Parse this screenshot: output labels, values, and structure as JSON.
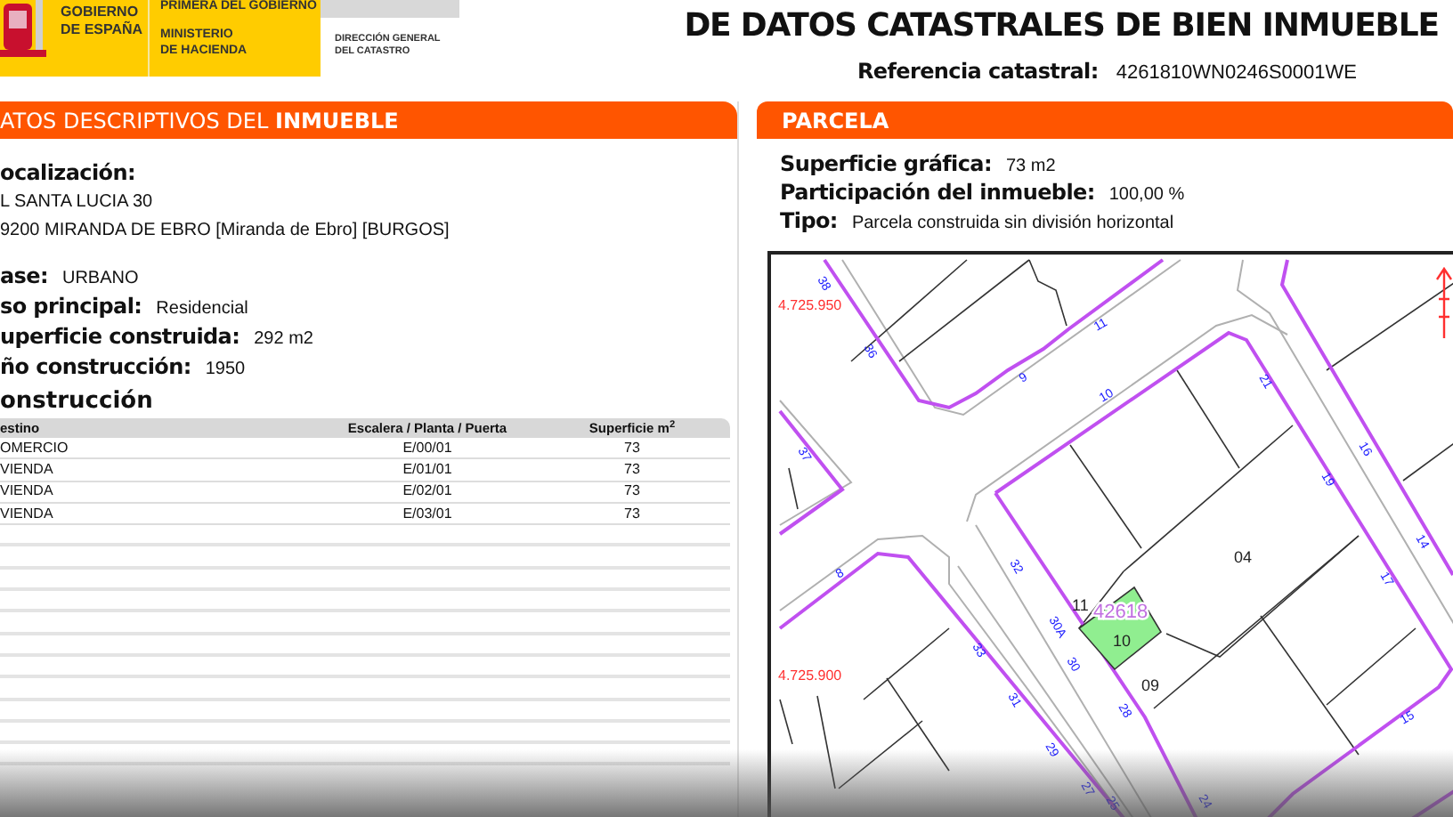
{
  "header": {
    "logo_texts": [
      "GOBIERNO",
      "DE ESPAÑA"
    ],
    "ministry_top": "PRIMERA DEL GOBIERNO",
    "ministry": [
      "MINISTERIO",
      "DE HACIENDA"
    ],
    "directorate": [
      "DIRECCIÓN GENERAL",
      "DEL CATASTRO"
    ],
    "title": "DE DATOS CATASTRALES DE BIEN INMUEBLE",
    "reference_label": "Referencia catastral:",
    "reference_value": "4261810WN0246S0001WE"
  },
  "left_panel": {
    "title": "ATOS DESCRIPTIVOS DEL **INMUEBLE**",
    "location_label": "ocalización:",
    "address": [
      "L SANTA LUCIA 30",
      "9200 MIRANDA DE EBRO [Miranda de Ebro] [BURGOS]"
    ],
    "fields": [
      {
        "label": "ase:",
        "value": "URBANO"
      },
      {
        "label": "so principal:",
        "value": "Residencial"
      },
      {
        "label": "uperficie construida:",
        "value": "292 m2"
      },
      {
        "label": "ño construcción:",
        "value": "1950"
      }
    ],
    "table_title": "onstrucción",
    "table": {
      "columns": [
        "estino",
        "Escalera / Planta / Puerta",
        "Superficie m$^{2}$"
      ],
      "rows": [
        [
          "OMERCIO",
          "E/00/01",
          "73"
        ],
        [
          "VIENDA",
          "E/01/01",
          "73"
        ],
        [
          "VIENDA",
          "E/02/01",
          "73"
        ],
        [
          "VIENDA",
          "E/03/01",
          "73"
        ]
      ]
    }
  },
  "right_panel": {
    "title": "PARCELA",
    "fields": [
      {
        "label": "Superficie gráfica:",
        "value": "73 m2"
      },
      {
        "label": "Participación del inmueble:",
        "value": "100,00 %"
      },
      {
        "label": "Tipo:",
        "value": "Parcela construida sin división horizontal"
      }
    ],
    "map": {
      "labels": [
        {
          "text": "4.725.950",
          "kind": "coordinate"
        },
        {
          "text": "4.725.900",
          "kind": "coordinate"
        },
        {
          "text": "38",
          "kind": "street"
        },
        {
          "text": "36",
          "kind": "street"
        },
        {
          "text": "11",
          "kind": "street"
        },
        {
          "text": "9",
          "kind": "street"
        },
        {
          "text": "10",
          "kind": "street"
        },
        {
          "text": "21",
          "kind": "street"
        },
        {
          "text": "16",
          "kind": "street"
        },
        {
          "text": "19",
          "kind": "street"
        },
        {
          "text": "14",
          "kind": "street"
        },
        {
          "text": "17",
          "kind": "street"
        },
        {
          "text": "15",
          "kind": "street"
        },
        {
          "text": "37",
          "kind": "street"
        },
        {
          "text": "8",
          "kind": "street"
        },
        {
          "text": "32",
          "kind": "street"
        },
        {
          "text": "30A",
          "kind": "street"
        },
        {
          "text": "30",
          "kind": "street"
        },
        {
          "text": "33",
          "kind": "street"
        },
        {
          "text": "31",
          "kind": "street"
        },
        {
          "text": "28",
          "kind": "street"
        },
        {
          "text": "29",
          "kind": "street"
        },
        {
          "text": "27",
          "kind": "street"
        },
        {
          "text": "25",
          "kind": "street"
        },
        {
          "text": "24",
          "kind": "street"
        },
        {
          "text": "04",
          "kind": "parcel"
        },
        {
          "text": "11",
          "kind": "parcel"
        },
        {
          "text": "10",
          "kind": "parcel"
        },
        {
          "text": "09",
          "kind": "parcel"
        },
        {
          "text": "42618",
          "kind": "block"
        }
      ]
    }
  }
}
